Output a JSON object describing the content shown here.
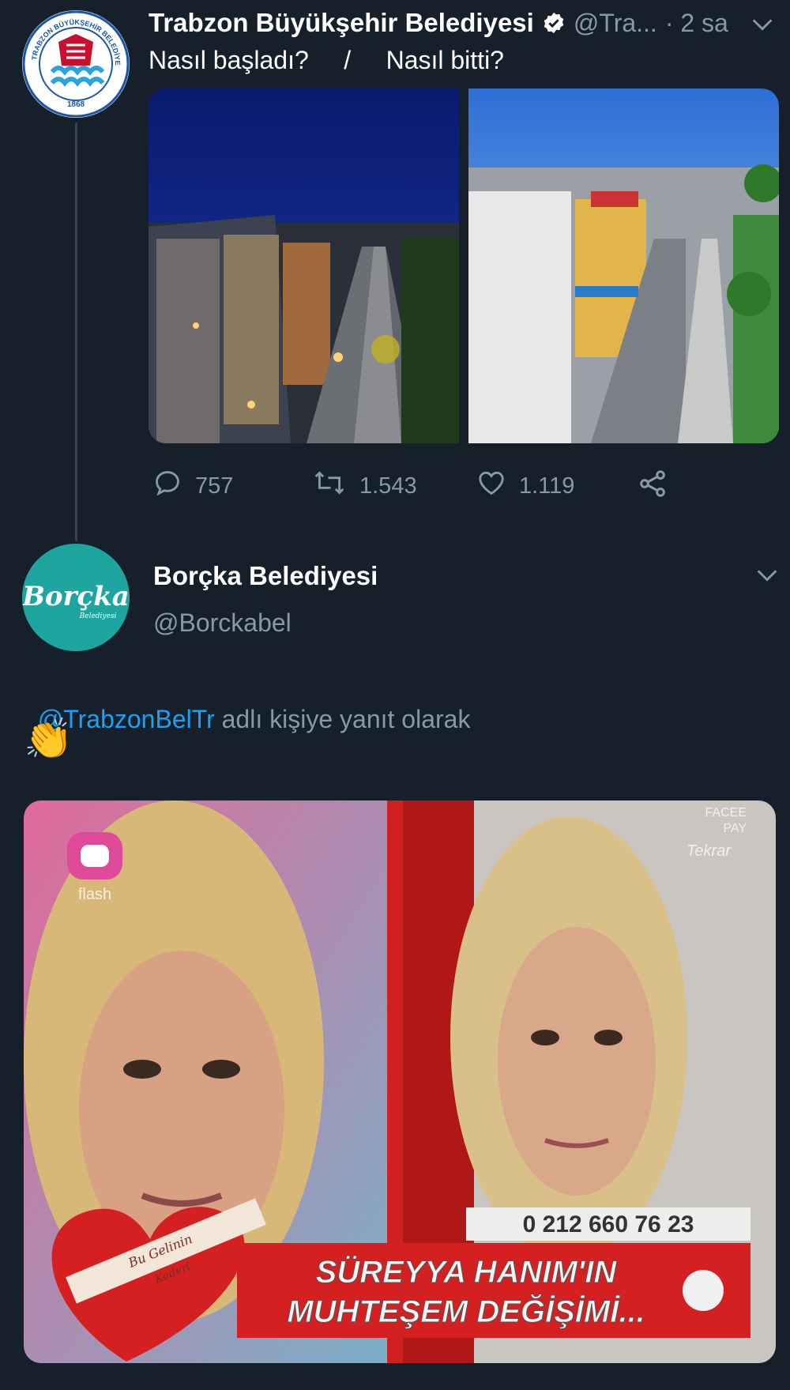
{
  "tweet1": {
    "author_name": "Trabzon Büyükşehir Belediyesi",
    "handle": "@Tra...",
    "time": "· 2 sa",
    "text": "Nasıl başladı?     /     Nasıl bitti?",
    "logo_top_text": "TRABZON BÜYÜKŞEHİR BELEDİYESİ",
    "logo_year": "1868",
    "actions": {
      "replies": "757",
      "retweets": "1.543",
      "likes": "1.119"
    },
    "icons": [
      "verified-badge-icon",
      "chevron-down-icon",
      "reply-icon",
      "retweet-icon",
      "like-icon",
      "share-icon"
    ]
  },
  "tweet2": {
    "author_name": "Borçka Belediyesi",
    "handle": "@Borckabel",
    "logo_text": "Borçka",
    "logo_subtext": "Belediyesi",
    "reply_to_handle": "@TrabzonBelTr",
    "reply_to_suffix": " adlı kişiye yanıt olarak",
    "emoji": "👏",
    "icons": [
      "chevron-down-icon"
    ],
    "media": {
      "channel_logo": "flash",
      "top_right_1": "FACEE",
      "top_right_2": "PAY",
      "top_right_3": "Tekrar",
      "phone": "0 212 660 76 23",
      "banner_line1": "SÜREYYA HANIM'IN",
      "banner_line2": "MUHTEŞEM DEĞİŞİMİ...",
      "heart_text": "Bu Gelinin",
      "heart_subtext": "Kaderi"
    }
  },
  "colors": {
    "background": "#15202b",
    "link": "#1da1f2",
    "muted": "#8899a6",
    "thread_line": "#38444d"
  }
}
